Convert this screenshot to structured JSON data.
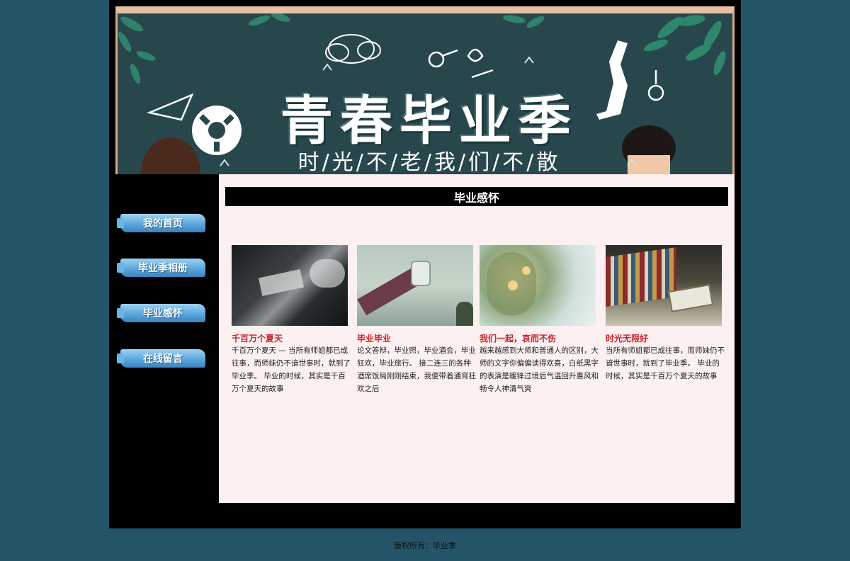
{
  "banner": {
    "title": "青春毕业季",
    "subtitle": "时/光/不/老/我/们/不/散"
  },
  "nav": {
    "items": [
      {
        "label": "我的首页"
      },
      {
        "label": "毕业季相册"
      },
      {
        "label": "毕业感怀"
      },
      {
        "label": "在线留言"
      }
    ]
  },
  "main": {
    "section_title": "毕业感怀",
    "cards": [
      {
        "title": "千百万个夏天",
        "desc": "千百万个夏天 — 当所有师姐都已成往事，而师妹仍不谙世事时，就到了毕业季。 毕业的时候，其实是千百万个夏天的故事"
      },
      {
        "title": "毕业毕业",
        "desc": "论文答辩，毕业照，毕业酒会，毕业狂欢，毕业旅行。 接二连三的各种酒席饭局刚刚结束，我便带着通宵狂欢之后"
      },
      {
        "title": "我们一起，哀而不伤",
        "desc": "越来越感到大师和普通人的区别，大师的文字你偏偏读得欢喜，白纸黑字的表演是暖锋过境后气温回升惠风和畅令人神清气爽"
      },
      {
        "title": "时光无限好",
        "desc": "当所有师姐都已成往事，而师妹仍不谙世事时，就到了毕业季。 毕业的时候，其实是千百万个夏天的故事"
      }
    ]
  },
  "footer": {
    "text": "版权所有：毕业季"
  },
  "colors": {
    "page_bg": "#245468",
    "frame_bg": "#000000",
    "content_bg": "#fdf0f0",
    "card_title": "#c8242a",
    "nav_button": "#5ba8dc"
  }
}
